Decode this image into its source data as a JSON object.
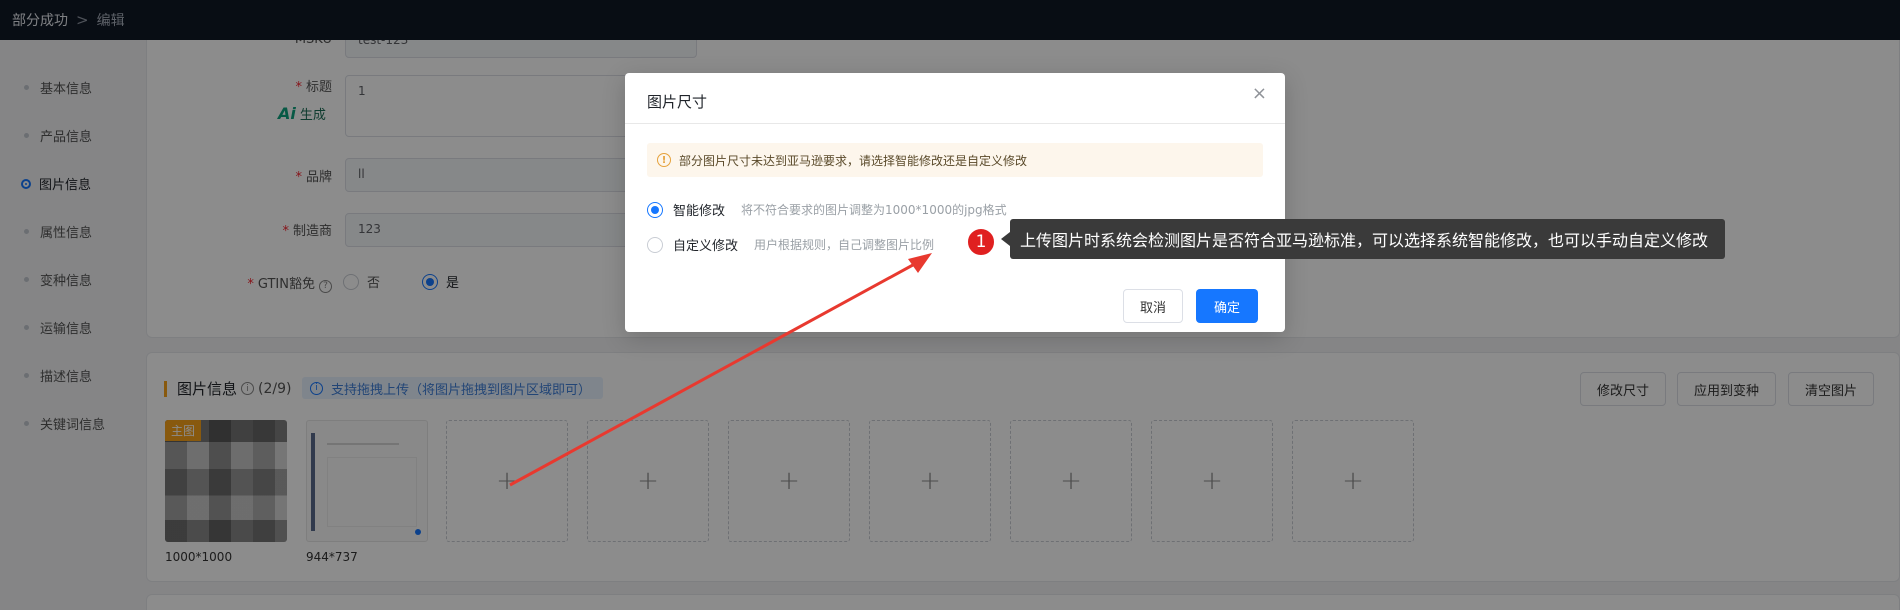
{
  "breadcrumb": {
    "parent": "部分成功",
    "separator": ">",
    "current": "编辑"
  },
  "sidebar": {
    "items": [
      {
        "label": "基本信息",
        "active": false
      },
      {
        "label": "产品信息",
        "active": false
      },
      {
        "label": "图片信息",
        "active": true
      },
      {
        "label": "属性信息",
        "active": false
      },
      {
        "label": "变种信息",
        "active": false
      },
      {
        "label": "运输信息",
        "active": false
      },
      {
        "label": "描述信息",
        "active": false
      },
      {
        "label": "关键词信息",
        "active": false
      }
    ]
  },
  "form": {
    "msku_label": "MSKU",
    "msku_value": "test-123",
    "title_label": "标题",
    "title_value": "1",
    "ai_label": "生成",
    "ai_mark": "Ai",
    "brand_label": "品牌",
    "brand_value": "ll",
    "maker_label": "制造商",
    "maker_value": "123",
    "gtin_label": "GTIN豁免",
    "gtin_options": [
      "否",
      "是"
    ],
    "gtin_selected": "是"
  },
  "images": {
    "title": "图片信息",
    "count": "(2/9)",
    "drag_tip": "支持拖拽上传（将图片拖拽到图片区域即可）",
    "buttons": [
      "修改尺寸",
      "应用到变种",
      "清空图片"
    ],
    "main_badge": "主图",
    "sizes": [
      "1000*1000",
      "944*737"
    ],
    "empty_slot_icon": "+"
  },
  "modal": {
    "title": "图片尺寸",
    "close_icon": "×",
    "warning": "部分图片尺寸未达到亚马逊要求，请选择智能修改还是自定义修改",
    "options": [
      {
        "label": "智能修改",
        "desc": "将不符合要求的图片调整为1000*1000的jpg格式",
        "checked": true
      },
      {
        "label": "自定义修改",
        "desc": "用户根据规则，自己调整图片比例",
        "checked": false
      }
    ],
    "cancel": "取消",
    "confirm": "确定"
  },
  "annotation": {
    "step": "1",
    "text": "上传图片时系统会检测图片是否符合亚马逊标准，可以选择系统智能修改，也可以手动自定义修改",
    "arrow_color": "#e8392f"
  }
}
